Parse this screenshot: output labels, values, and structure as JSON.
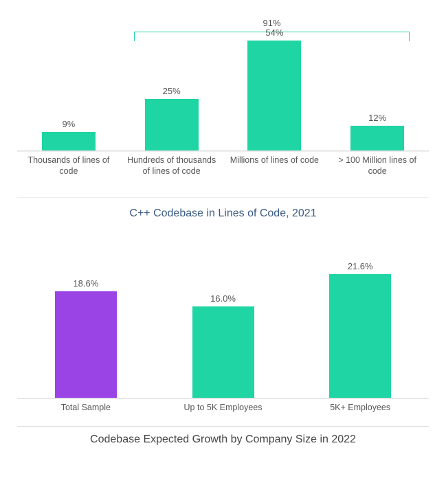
{
  "chart_data": [
    {
      "type": "bar",
      "title": "C++ Codebase in Lines of Code, 2021",
      "categories": [
        "Thousands of lines of code",
        "Hundreds of thousands of lines of code",
        "Millions of lines of code",
        "> 100 Million lines of code"
      ],
      "values": [
        9,
        25,
        54,
        12
      ],
      "value_labels": [
        "9%",
        "25%",
        "54%",
        "12%"
      ],
      "ylim": [
        0,
        60
      ],
      "annotation": {
        "label": "91%",
        "span_start": 1,
        "span_end": 3
      }
    },
    {
      "type": "bar",
      "title": "Codebase Expected Growth by Company Size in 2022",
      "categories": [
        "Total Sample",
        "Up to 5K Employees",
        "5K+ Employees"
      ],
      "values": [
        18.6,
        16.0,
        21.6
      ],
      "value_labels": [
        "18.6%",
        "16.0%",
        "21.6%"
      ],
      "colors": [
        "purple",
        "teal",
        "teal"
      ],
      "ylim": [
        0,
        25
      ]
    }
  ]
}
